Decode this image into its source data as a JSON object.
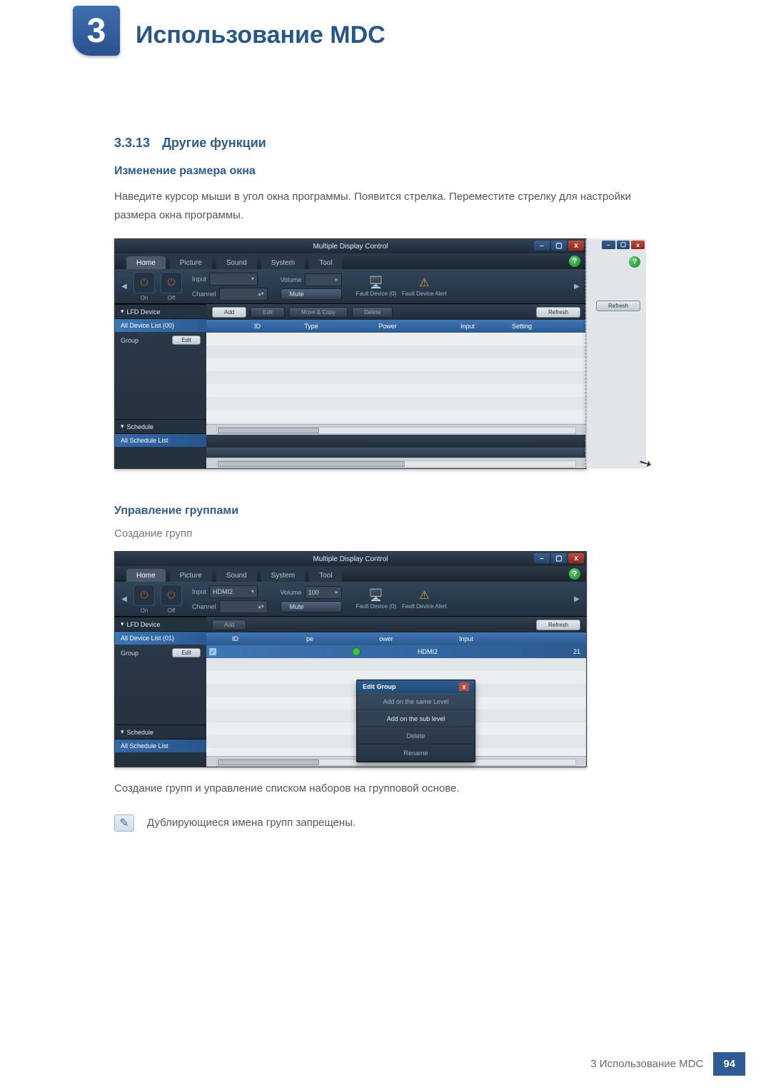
{
  "chapter": {
    "number": "3",
    "title": "Использование MDC"
  },
  "section": {
    "number": "3.3.13",
    "title": "Другие функции"
  },
  "subsection1": {
    "heading": "Изменение размера окна",
    "body": "Наведите курсор мыши в угол окна программы. Появится стрелка. Переместите стрелку для настройки размера окна программы."
  },
  "subsection2": {
    "heading": "Управление группами",
    "subheading": "Создание групп",
    "caption": "Создание групп и управление списком наборов на групповой основе.",
    "note": "Дублирующиеся имена групп запрещены."
  },
  "mdc_common": {
    "window_title": "Multiple Display Control",
    "tabs": {
      "home": "Home",
      "picture": "Picture",
      "sound": "Sound",
      "system": "System",
      "tool": "Tool"
    },
    "ribbon": {
      "input_label": "Input",
      "channel_label": "Channel",
      "volume_label": "Volume",
      "mute": "Mute",
      "fault_device_count": "Fault Device (0)",
      "fault_device_alert": "Fault Device Alert",
      "on": "On",
      "off": "Off",
      "help": "?"
    },
    "side": {
      "lfd": "LFD Device",
      "schedule": "Schedule",
      "all_schedule": "All Schedule List",
      "group": "Group",
      "edit": "Edit"
    },
    "toolbar": {
      "add": "Add",
      "edit": "Edit",
      "move_copy": "Move & Copy",
      "delete": "Delete",
      "refresh": "Refresh"
    },
    "columns": {
      "id": "ID",
      "type": "Type",
      "power": "Power",
      "input": "Input",
      "setting": "Setting"
    }
  },
  "shot1": {
    "all_device": "All Device List (00)"
  },
  "shot2": {
    "all_device": "All Device List (01)",
    "input_value": "HDMI2",
    "volume_value": "100",
    "row": {
      "input": "HDMI2",
      "setting_col": "21",
      "power_col_hdr_b": "ower",
      "type_col_hdr_b": "pe"
    },
    "ctx": {
      "title": "Edit Group",
      "items": [
        "Add on the same Level",
        "Add on the sub level",
        "Delete",
        "Rename"
      ]
    }
  },
  "footer": {
    "text": "3 Использование MDC",
    "page": "94"
  }
}
